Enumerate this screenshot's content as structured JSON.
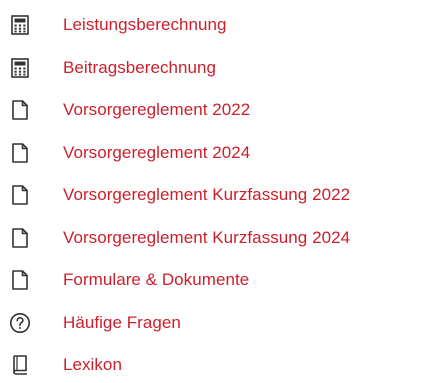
{
  "links": {
    "accent_color": "#cc1f2b",
    "items": [
      {
        "label": "Leistungsberechnung",
        "icon": "calculator-icon"
      },
      {
        "label": "Beitragsberechnung",
        "icon": "calculator-icon"
      },
      {
        "label": "Vorsorgereglement 2022",
        "icon": "document-icon"
      },
      {
        "label": "Vorsorgereglement 2024",
        "icon": "document-icon"
      },
      {
        "label": "Vorsorgereglement Kurzfassung 2022",
        "icon": "document-icon"
      },
      {
        "label": "Vorsorgereglement Kurzfassung 2024",
        "icon": "document-icon"
      },
      {
        "label": "Formulare & Dokumente",
        "icon": "document-icon"
      },
      {
        "label": "Häufige Fragen",
        "icon": "question-circle-icon"
      },
      {
        "label": "Lexikon",
        "icon": "book-icon"
      }
    ]
  }
}
